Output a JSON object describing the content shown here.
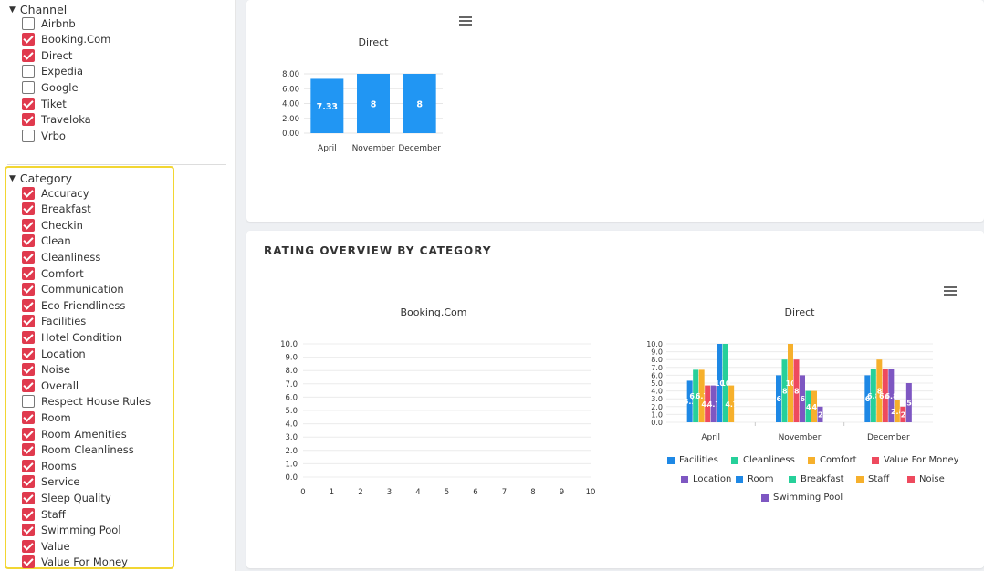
{
  "sidebar": {
    "channel": {
      "title": "Channel",
      "items": [
        {
          "label": "Airbnb",
          "checked": false
        },
        {
          "label": "Booking.Com",
          "checked": true
        },
        {
          "label": "Direct",
          "checked": true
        },
        {
          "label": "Expedia",
          "checked": false
        },
        {
          "label": "Google",
          "checked": false
        },
        {
          "label": "Tiket",
          "checked": true
        },
        {
          "label": "Traveloka",
          "checked": true
        },
        {
          "label": "Vrbo",
          "checked": false
        }
      ]
    },
    "category": {
      "title": "Category",
      "items": [
        {
          "label": "Accuracy",
          "checked": true
        },
        {
          "label": "Breakfast",
          "checked": true
        },
        {
          "label": "Checkin",
          "checked": true
        },
        {
          "label": "Clean",
          "checked": true
        },
        {
          "label": "Cleanliness",
          "checked": true
        },
        {
          "label": "Comfort",
          "checked": true
        },
        {
          "label": "Communication",
          "checked": true
        },
        {
          "label": "Eco Friendliness",
          "checked": true
        },
        {
          "label": "Facilities",
          "checked": true
        },
        {
          "label": "Hotel Condition",
          "checked": true
        },
        {
          "label": "Location",
          "checked": true
        },
        {
          "label": "Noise",
          "checked": true
        },
        {
          "label": "Overall",
          "checked": true
        },
        {
          "label": "Respect House Rules",
          "checked": false
        },
        {
          "label": "Room",
          "checked": true
        },
        {
          "label": "Room Amenities",
          "checked": true
        },
        {
          "label": "Room Cleanliness",
          "checked": true
        },
        {
          "label": "Rooms",
          "checked": true
        },
        {
          "label": "Service",
          "checked": true
        },
        {
          "label": "Sleep Quality",
          "checked": true
        },
        {
          "label": "Staff",
          "checked": true
        },
        {
          "label": "Swimming Pool",
          "checked": true
        },
        {
          "label": "Value",
          "checked": true
        },
        {
          "label": "Value For Money",
          "checked": true
        }
      ]
    }
  },
  "panels": {
    "bottom_heading": "RATING OVERVIEW BY CATEGORY"
  },
  "colors": {
    "checkbox_checked": "#e03a4e",
    "highlight_border": "#f2d632",
    "bar_blue": "#2196f3"
  },
  "chart_data": [
    {
      "type": "bar",
      "title": "Direct",
      "categories": [
        "April",
        "November",
        "December"
      ],
      "values": [
        7.33,
        8,
        8
      ],
      "data_labels": [
        "7.33",
        "8",
        "8"
      ],
      "y_ticks": [
        "0.00",
        "2.00",
        "4.00",
        "6.00",
        "8.00"
      ],
      "ylim": [
        0,
        8
      ],
      "color": "#2196f3",
      "grid": true
    },
    {
      "type": "bar",
      "title": "Booking.Com",
      "categories": [],
      "x_ticks": [
        "0",
        "1",
        "2",
        "3",
        "4",
        "5",
        "6",
        "7",
        "8",
        "9",
        "10"
      ],
      "y_ticks": [
        "0.0",
        "1.0",
        "2.0",
        "3.0",
        "4.0",
        "5.0",
        "6.0",
        "7.0",
        "8.0",
        "9.0",
        "10.0"
      ],
      "xlim": [
        0,
        10
      ],
      "ylim": [
        0,
        10
      ],
      "grid": true
    },
    {
      "type": "bar",
      "title": "Direct",
      "categories": [
        "April",
        "November",
        "December"
      ],
      "y_ticks": [
        "0.0",
        "1.0",
        "2.0",
        "3.0",
        "4.0",
        "5.0",
        "6.0",
        "7.0",
        "8.0",
        "9.0",
        "10.0"
      ],
      "ylim": [
        0,
        10
      ],
      "grid": true,
      "legend_position": "bottom",
      "series": [
        {
          "name": "Facilities",
          "color": "#1e88e5",
          "values": [
            5.3,
            6,
            6
          ]
        },
        {
          "name": "Cleanliness",
          "color": "#26d09a",
          "values": [
            6.7,
            8,
            6.8
          ]
        },
        {
          "name": "Comfort",
          "color": "#f6b02c",
          "values": [
            6.7,
            10,
            8
          ]
        },
        {
          "name": "Value For Money",
          "color": "#ee4a5e",
          "values": [
            4.7,
            8,
            6.8
          ]
        },
        {
          "name": "Location",
          "color": "#7e57c2",
          "values": [
            4.7,
            6,
            6.8
          ]
        },
        {
          "name": "Room",
          "color": "#1e88e5",
          "values": [
            10,
            null,
            null
          ]
        },
        {
          "name": "Breakfast",
          "color": "#26d09a",
          "values": [
            10,
            4,
            null
          ]
        },
        {
          "name": "Staff",
          "color": "#f6b02c",
          "values": [
            4.7,
            4,
            2.8
          ]
        },
        {
          "name": "Noise",
          "color": "#ee4a5e",
          "values": [
            null,
            null,
            2
          ]
        },
        {
          "name": "Swimming Pool",
          "color": "#7e57c2",
          "values": [
            null,
            2,
            5
          ]
        }
      ]
    }
  ]
}
